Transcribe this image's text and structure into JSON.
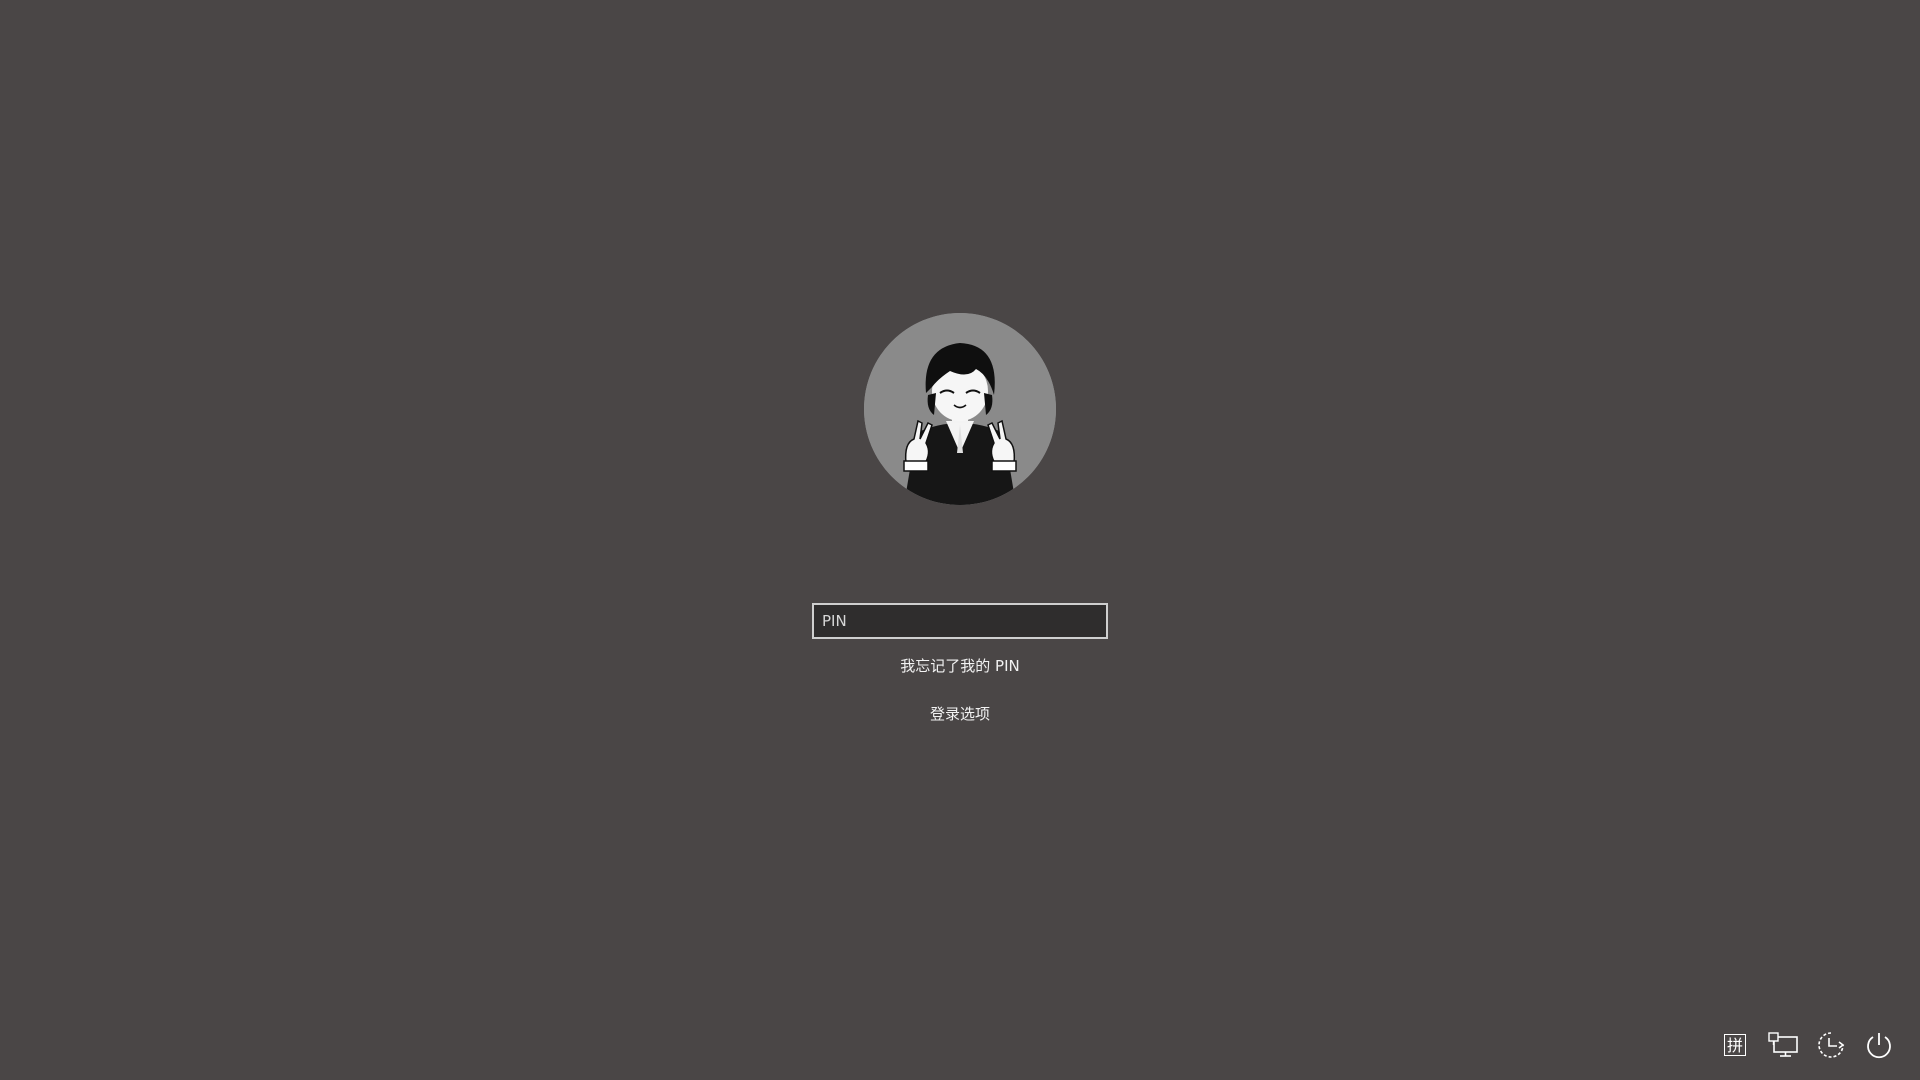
{
  "login": {
    "avatar_icon": "user-avatar",
    "pin_placeholder": "PIN",
    "pin_value": "",
    "forgot_pin_label": "我忘记了我的 PIN",
    "signin_options_label": "登录选项"
  },
  "tray": {
    "ime_label": "拼",
    "icons": [
      "ime-icon",
      "network-icon",
      "accessibility-icon",
      "power-icon"
    ]
  },
  "colors": {
    "background": "#4a4646",
    "input_border": "#cfcfcf",
    "input_bg": "#2f2d2d",
    "text": "#ffffff"
  }
}
